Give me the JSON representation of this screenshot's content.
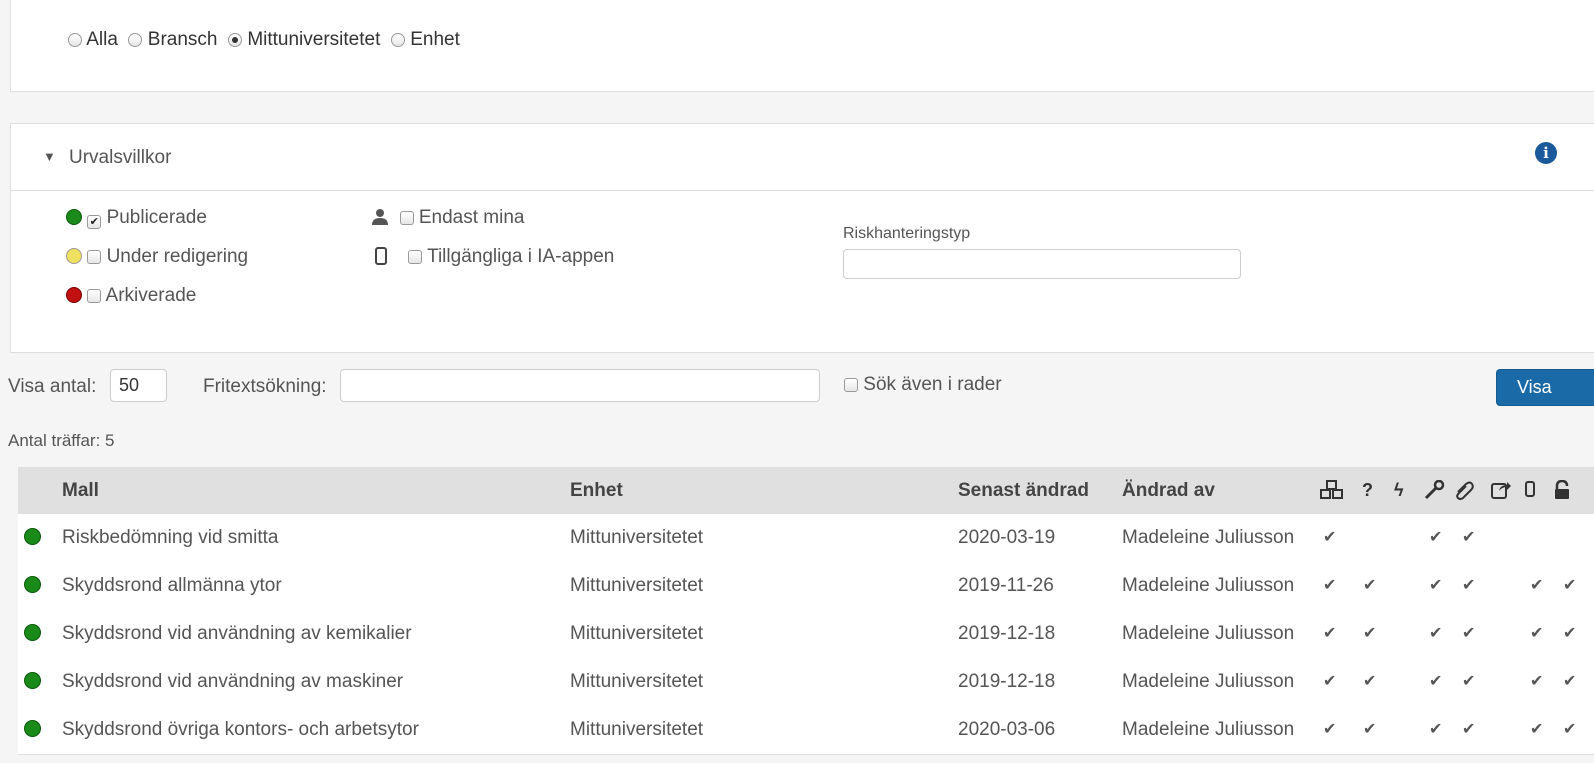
{
  "scope": {
    "options": [
      {
        "label": "Alla",
        "selected": false
      },
      {
        "label": "Bransch",
        "selected": false
      },
      {
        "label": "Mittuniversitetet",
        "selected": true
      },
      {
        "label": "Enhet",
        "selected": false
      }
    ]
  },
  "filter": {
    "title": "Urvalsvillkor",
    "status": [
      {
        "label": "Publicerade",
        "checked": true,
        "color": "#1a8a1a"
      },
      {
        "label": "Under redigering",
        "checked": false,
        "color": "#f0e060"
      },
      {
        "label": "Arkiverade",
        "checked": false,
        "color": "#c01010"
      }
    ],
    "only_mine": "Endast mina",
    "ia_app": "Tillgängliga i IA-appen",
    "risk_type_label": "Riskhanteringstyp",
    "risk_type_value": ""
  },
  "search": {
    "count_label": "Visa antal:",
    "count_value": "50",
    "freetext_label": "Fritextsökning:",
    "freetext_value": "",
    "search_rows_label": "Sök även i rader",
    "show_button": "Visa"
  },
  "hits": "Antal träffar: 5",
  "table": {
    "headers": {
      "mall": "Mall",
      "enhet": "Enhet",
      "changed": "Senast ändrad",
      "changed_by": "Ändrad av"
    },
    "rows": [
      {
        "mall": "Riskbedömning vid smitta",
        "enhet": "Mittuniversitetet",
        "date": "2020-03-19",
        "by": "Madeleine Juliusson",
        "checks": [
          true,
          false,
          false,
          true,
          true,
          false,
          false,
          false
        ]
      },
      {
        "mall": "Skyddsrond allmänna ytor",
        "enhet": "Mittuniversitetet",
        "date": "2019-11-26",
        "by": "Madeleine Juliusson",
        "checks": [
          true,
          true,
          false,
          true,
          true,
          false,
          true,
          true
        ]
      },
      {
        "mall": "Skyddsrond vid användning av kemikalier",
        "enhet": "Mittuniversitetet",
        "date": "2019-12-18",
        "by": "Madeleine Juliusson",
        "checks": [
          true,
          true,
          false,
          true,
          true,
          false,
          true,
          true
        ]
      },
      {
        "mall": "Skyddsrond vid användning av maskiner",
        "enhet": "Mittuniversitetet",
        "date": "2019-12-18",
        "by": "Madeleine Juliusson",
        "checks": [
          true,
          true,
          false,
          true,
          true,
          false,
          true,
          true
        ]
      },
      {
        "mall": "Skyddsrond övriga kontors- och arbetsytor",
        "enhet": "Mittuniversitetet",
        "date": "2020-03-06",
        "by": "Madeleine Juliusson",
        "checks": [
          true,
          true,
          false,
          true,
          true,
          false,
          true,
          true
        ]
      }
    ]
  },
  "colors": {
    "primary": "#1a6aa8",
    "published": "#1a8a1a",
    "info": "#1a5a9a"
  },
  "icons": [
    "cubes-icon",
    "question-icon",
    "bolt-icon",
    "wrench-icon",
    "paperclip-icon",
    "share-icon",
    "mobile-icon",
    "lock-icon"
  ]
}
